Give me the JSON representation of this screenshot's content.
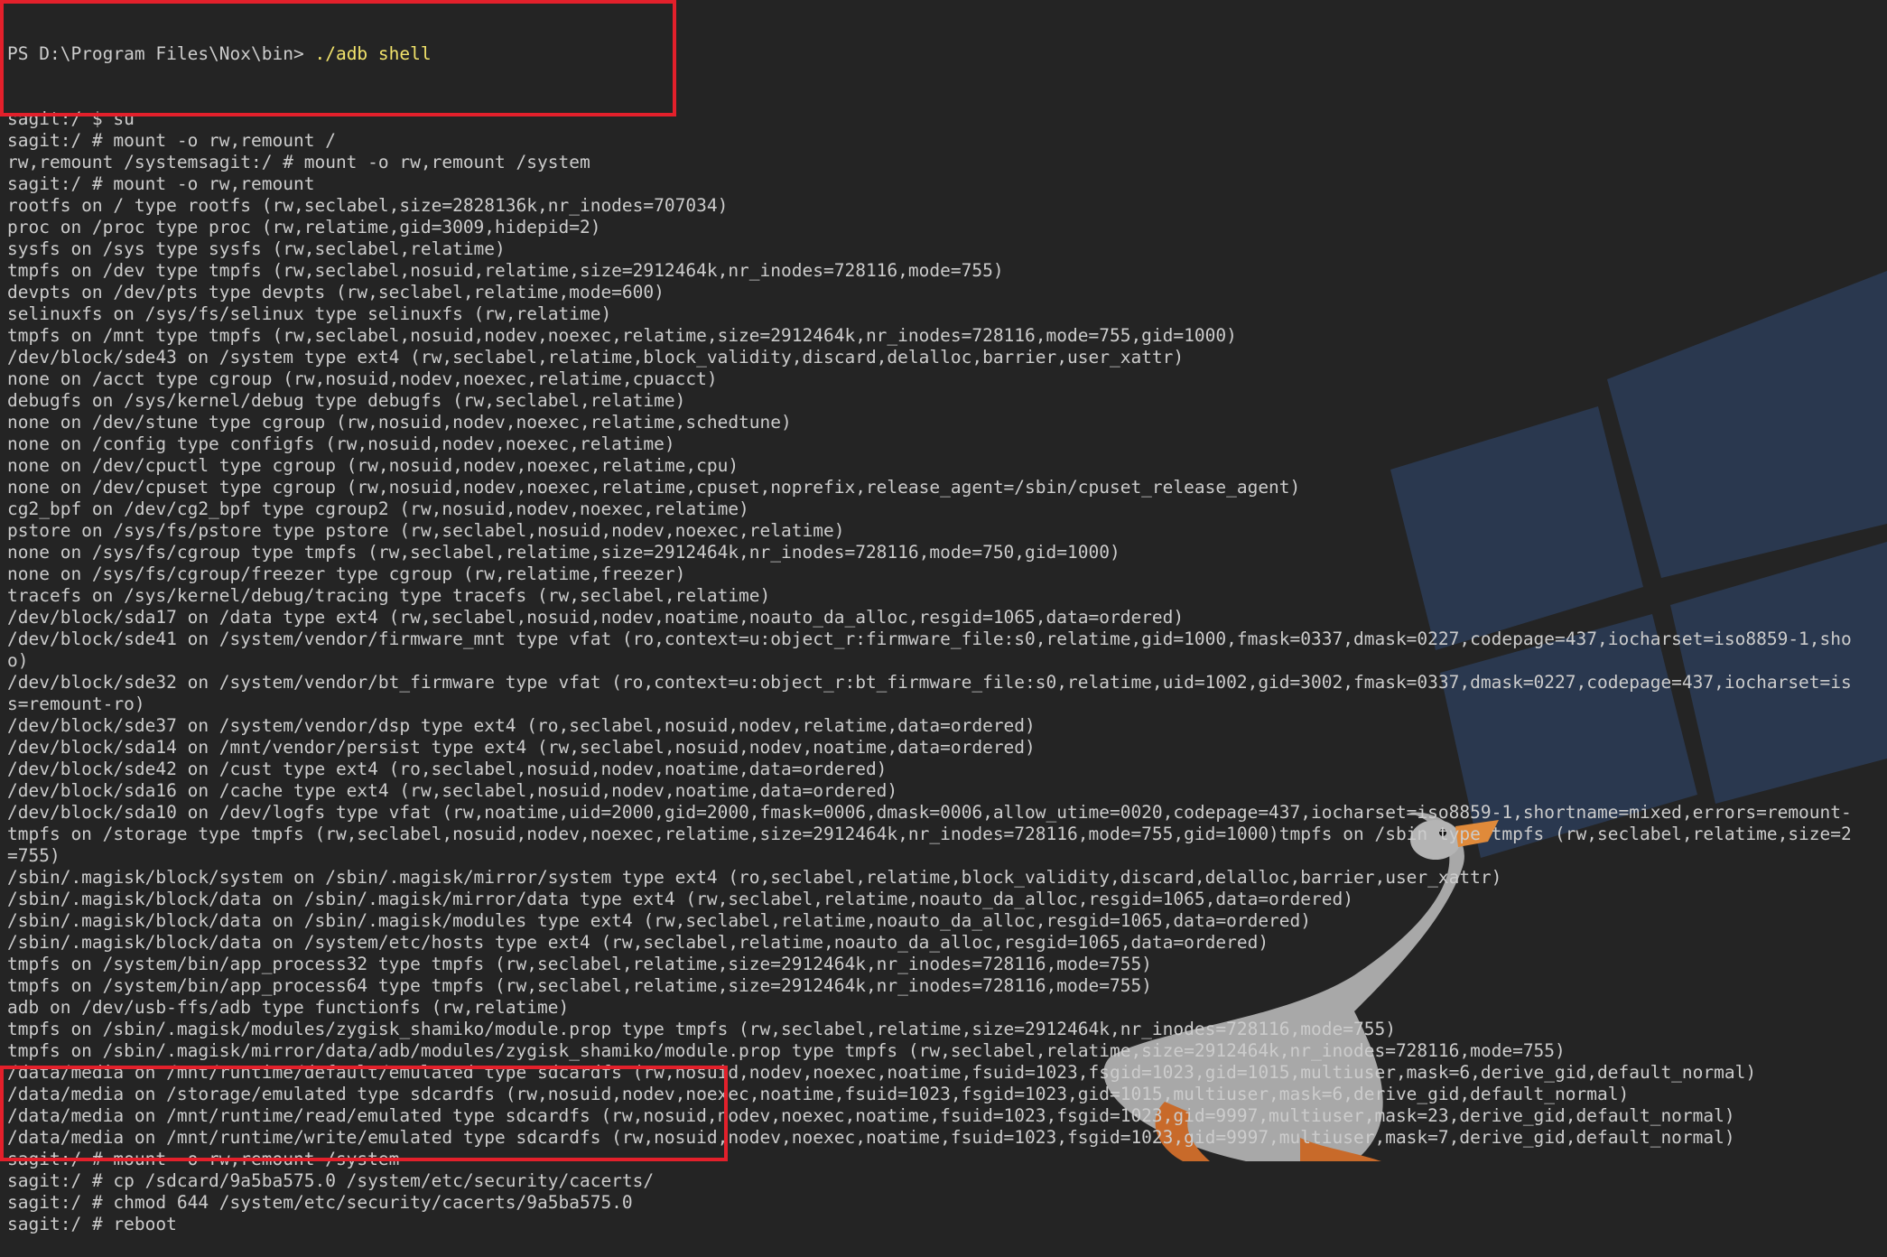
{
  "colors": {
    "background": "#242424",
    "text": "#cccccc",
    "command_highlight": "#f2e36b",
    "annotation_box": "#e3202b",
    "windows_logo": "#2b3a52"
  },
  "icons": [
    "windows-logo-icon",
    "goose-illustration-icon"
  ],
  "terminal": {
    "prompt_line": {
      "prompt": "PS D:\\Program Files\\Nox\\bin> ",
      "command": "./adb shell"
    },
    "lines": [
      "sagit:/ $ su",
      "sagit:/ # mount -o rw,remount /",
      "rw,remount /systemsagit:/ # mount -o rw,remount /system",
      "sagit:/ # mount -o rw,remount",
      "rootfs on / type rootfs (rw,seclabel,size=2828136k,nr_inodes=707034)",
      "proc on /proc type proc (rw,relatime,gid=3009,hidepid=2)",
      "sysfs on /sys type sysfs (rw,seclabel,relatime)",
      "tmpfs on /dev type tmpfs (rw,seclabel,nosuid,relatime,size=2912464k,nr_inodes=728116,mode=755)",
      "devpts on /dev/pts type devpts (rw,seclabel,relatime,mode=600)",
      "selinuxfs on /sys/fs/selinux type selinuxfs (rw,relatime)",
      "tmpfs on /mnt type tmpfs (rw,seclabel,nosuid,nodev,noexec,relatime,size=2912464k,nr_inodes=728116,mode=755,gid=1000)",
      "/dev/block/sde43 on /system type ext4 (rw,seclabel,relatime,block_validity,discard,delalloc,barrier,user_xattr)",
      "none on /acct type cgroup (rw,nosuid,nodev,noexec,relatime,cpuacct)",
      "debugfs on /sys/kernel/debug type debugfs (rw,seclabel,relatime)",
      "none on /dev/stune type cgroup (rw,nosuid,nodev,noexec,relatime,schedtune)",
      "none on /config type configfs (rw,nosuid,nodev,noexec,relatime)",
      "none on /dev/cpuctl type cgroup (rw,nosuid,nodev,noexec,relatime,cpu)",
      "none on /dev/cpuset type cgroup (rw,nosuid,nodev,noexec,relatime,cpuset,noprefix,release_agent=/sbin/cpuset_release_agent)",
      "cg2_bpf on /dev/cg2_bpf type cgroup2 (rw,nosuid,nodev,noexec,relatime)",
      "pstore on /sys/fs/pstore type pstore (rw,seclabel,nosuid,nodev,noexec,relatime)",
      "none on /sys/fs/cgroup type tmpfs (rw,seclabel,relatime,size=2912464k,nr_inodes=728116,mode=750,gid=1000)",
      "none on /sys/fs/cgroup/freezer type cgroup (rw,relatime,freezer)",
      "tracefs on /sys/kernel/debug/tracing type tracefs (rw,seclabel,relatime)",
      "/dev/block/sda17 on /data type ext4 (rw,seclabel,nosuid,nodev,noatime,noauto_da_alloc,resgid=1065,data=ordered)",
      "/dev/block/sde41 on /system/vendor/firmware_mnt type vfat (ro,context=u:object_r:firmware_file:s0,relatime,gid=1000,fmask=0337,dmask=0227,codepage=437,iocharset=iso8859-1,sho",
      "o)",
      "/dev/block/sde32 on /system/vendor/bt_firmware type vfat (ro,context=u:object_r:bt_firmware_file:s0,relatime,uid=1002,gid=3002,fmask=0337,dmask=0227,codepage=437,iocharset=is",
      "s=remount-ro)",
      "/dev/block/sde37 on /system/vendor/dsp type ext4 (ro,seclabel,nosuid,nodev,relatime,data=ordered)",
      "/dev/block/sda14 on /mnt/vendor/persist type ext4 (rw,seclabel,nosuid,nodev,noatime,data=ordered)",
      "/dev/block/sde42 on /cust type ext4 (ro,seclabel,nosuid,nodev,noatime,data=ordered)",
      "/dev/block/sda16 on /cache type ext4 (rw,seclabel,nosuid,nodev,noatime,data=ordered)",
      "/dev/block/sda10 on /dev/logfs type vfat (rw,noatime,uid=2000,gid=2000,fmask=0006,dmask=0006,allow_utime=0020,codepage=437,iocharset=iso8859-1,shortname=mixed,errors=remount-",
      "tmpfs on /storage type tmpfs (rw,seclabel,nosuid,nodev,noexec,relatime,size=2912464k,nr_inodes=728116,mode=755,gid=1000)tmpfs on /sbin type tmpfs (rw,seclabel,relatime,size=2",
      "=755)",
      "/sbin/.magisk/block/system on /sbin/.magisk/mirror/system type ext4 (ro,seclabel,relatime,block_validity,discard,delalloc,barrier,user_xattr)",
      "/sbin/.magisk/block/data on /sbin/.magisk/mirror/data type ext4 (rw,seclabel,relatime,noauto_da_alloc,resgid=1065,data=ordered)",
      "/sbin/.magisk/block/data on /sbin/.magisk/modules type ext4 (rw,seclabel,relatime,noauto_da_alloc,resgid=1065,data=ordered)",
      "/sbin/.magisk/block/data on /system/etc/hosts type ext4 (rw,seclabel,relatime,noauto_da_alloc,resgid=1065,data=ordered)",
      "tmpfs on /system/bin/app_process32 type tmpfs (rw,seclabel,relatime,size=2912464k,nr_inodes=728116,mode=755)",
      "tmpfs on /system/bin/app_process64 type tmpfs (rw,seclabel,relatime,size=2912464k,nr_inodes=728116,mode=755)",
      "adb on /dev/usb-ffs/adb type functionfs (rw,relatime)",
      "tmpfs on /sbin/.magisk/modules/zygisk_shamiko/module.prop type tmpfs (rw,seclabel,relatime,size=2912464k,nr_inodes=728116,mode=755)",
      "tmpfs on /sbin/.magisk/mirror/data/adb/modules/zygisk_shamiko/module.prop type tmpfs (rw,seclabel,relatime,size=2912464k,nr_inodes=728116,mode=755)",
      "/data/media on /mnt/runtime/default/emulated type sdcardfs (rw,nosuid,nodev,noexec,noatime,fsuid=1023,fsgid=1023,gid=1015,multiuser,mask=6,derive_gid,default_normal)",
      "/data/media on /storage/emulated type sdcardfs (rw,nosuid,nodev,noexec,noatime,fsuid=1023,fsgid=1023,gid=1015,multiuser,mask=6,derive_gid,default_normal)",
      "/data/media on /mnt/runtime/read/emulated type sdcardfs (rw,nosuid,nodev,noexec,noatime,fsuid=1023,fsgid=1023,gid=9997,multiuser,mask=23,derive_gid,default_normal)",
      "/data/media on /mnt/runtime/write/emulated type sdcardfs (rw,nosuid,nodev,noexec,noatime,fsuid=1023,fsgid=1023,gid=9997,multiuser,mask=7,derive_gid,default_normal)",
      "sagit:/ # mount -o rw,remount /system",
      "sagit:/ # cp /sdcard/9a5ba575.0 /system/etc/security/cacerts/",
      "sagit:/ # chmod 644 /system/etc/security/cacerts/9a5ba575.0",
      "sagit:/ # reboot"
    ]
  }
}
